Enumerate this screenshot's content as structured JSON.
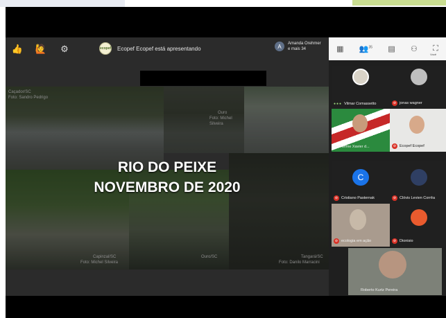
{
  "toolbar": {
    "left_buttons": [
      {
        "icon": "thumbs-up-icon",
        "glyph": "👍"
      },
      {
        "icon": "raise-hand-icon",
        "glyph": "🙋"
      },
      {
        "icon": "settings-icon",
        "glyph": "⚙"
      }
    ],
    "presenter_logo": "ecopef",
    "presenter_text": "Ecopef Ecopef está apresentando",
    "attendee_avatar": "A",
    "attendee_name": "Amanda Orehmer",
    "attendee_more": "e mais 34",
    "right_icons": [
      {
        "icon": "grid-layout-icon",
        "glyph": "▦",
        "badge": "",
        "sub": ""
      },
      {
        "icon": "participants-icon",
        "glyph": "👥",
        "badge": "35",
        "sub": ""
      },
      {
        "icon": "chat-icon",
        "glyph": "▤",
        "badge": "",
        "sub": ""
      },
      {
        "icon": "activities-icon",
        "glyph": "⚇",
        "badge": "",
        "sub": ""
      },
      {
        "icon": "fullscreen-icon",
        "glyph": "⛶",
        "badge": "",
        "sub": "Você"
      }
    ]
  },
  "slide": {
    "title_line1": "RIO DO PEIXE",
    "title_line2": "NOVEMBRO DE 2020",
    "captions": {
      "photo1": [
        "Caçador/SC",
        "Foto: Sandro Pedrigo"
      ],
      "photo2": [
        "Ouro",
        "Foto: Michel Silveira"
      ],
      "photo4": [
        "Capinzal/SC",
        "Foto: Michel Silveira"
      ],
      "photo5": [
        "Ouro/SC"
      ],
      "photo6": [
        "Tangará/SC",
        "Foto: Danilo Marracini"
      ]
    }
  },
  "participants": [
    {
      "name": "Vilmar Comassetto",
      "status": "speaking"
    },
    {
      "name": "jonas wagner",
      "status": "muted"
    },
    {
      "name": "Guilherme Xavier d...",
      "status": ""
    },
    {
      "name": "Ecopef Ecopef",
      "status": "muted"
    },
    {
      "name": "Cristiano Pasternak",
      "status": "muted",
      "initial": "C"
    },
    {
      "name": "Clóvis Levien Corrêa",
      "status": "muted"
    },
    {
      "name": "ecologia em ação",
      "status": "muted"
    },
    {
      "name": "Dionisio",
      "status": "muted"
    },
    {
      "name": "Roberto Kurtz Pereira",
      "status": ""
    }
  ],
  "colors": {
    "toolbar_bg": "#2b2b2b",
    "panel_bg": "#1f1f1f",
    "mic_muted": "#d93025",
    "avatar_blue": "#1a73e8",
    "avatar_orange": "#ea5b2e"
  }
}
